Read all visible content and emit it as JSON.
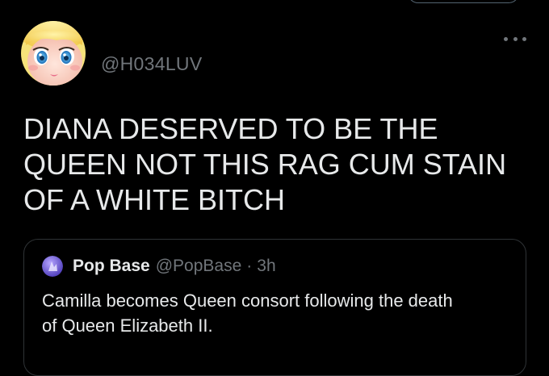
{
  "colors": {
    "background": "#000000",
    "text_primary": "#e7e9ea",
    "text_secondary": "#71767b",
    "card_border": "#2f3336"
  },
  "tweet": {
    "avatar_icon": "peach-avatar-icon",
    "handle": "@H034LUV",
    "more_icon": "more-options-icon",
    "text_lines": [
      "DIANA DESERVED TO BE THE",
      "QUEEN NOT THIS RAG CUM STAIN",
      "OF A WHITE BITCH"
    ]
  },
  "quoted_tweet": {
    "avatar_icon": "popbase-avatar-icon",
    "name": "Pop Base",
    "handle": "@PopBase",
    "separator": "·",
    "time": "3h",
    "text_lines": [
      "Camilla becomes Queen consort following the death",
      "of Queen Elizabeth II."
    ]
  }
}
